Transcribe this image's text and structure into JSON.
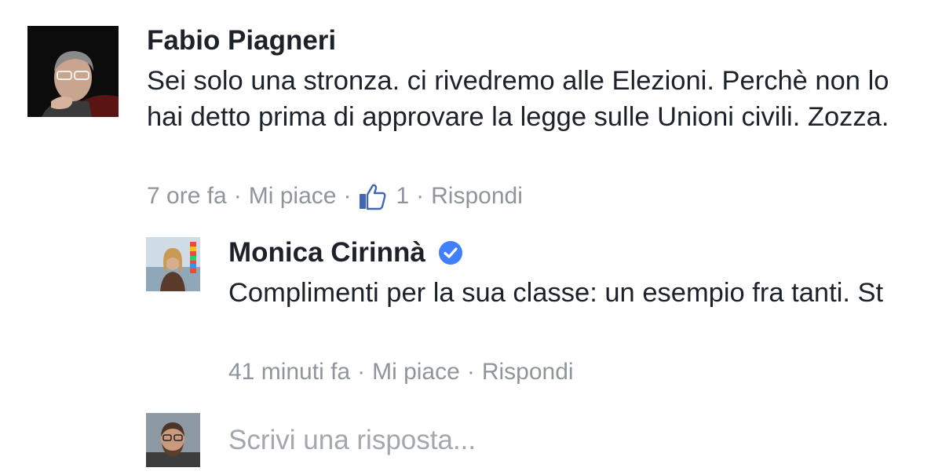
{
  "comment": {
    "author": "Fabio Piagneri",
    "text": "Sei solo una stronza. ci rivedremo alle Elezioni. Perchè non lo hai detto prima di approvare la legge sulle Unioni civili. Zozza.",
    "time": "7 ore fa",
    "like_label": "Mi piace",
    "like_count": "1",
    "reply_label": "Rispondi",
    "separator": "·",
    "avatar_icon": "user-photo-icon",
    "like_icon": "thumbs-up-icon"
  },
  "reply": {
    "author": "Monica Cirinnà",
    "verified_icon": "verified-badge-icon",
    "text": "Complimenti per la sua classe: un esempio fra tanti. St",
    "time": "41 minuti fa",
    "like_label": "Mi piace",
    "reply_label": "Rispondi",
    "separator": "·",
    "avatar_icon": "user-photo-icon"
  },
  "compose": {
    "placeholder": "Scrivi una risposta...",
    "avatar_icon": "user-photo-icon"
  },
  "colors": {
    "text": "#1d2129",
    "meta": "#90949c",
    "like_blue": "#4267b2",
    "verified_blue": "#4080ff"
  }
}
